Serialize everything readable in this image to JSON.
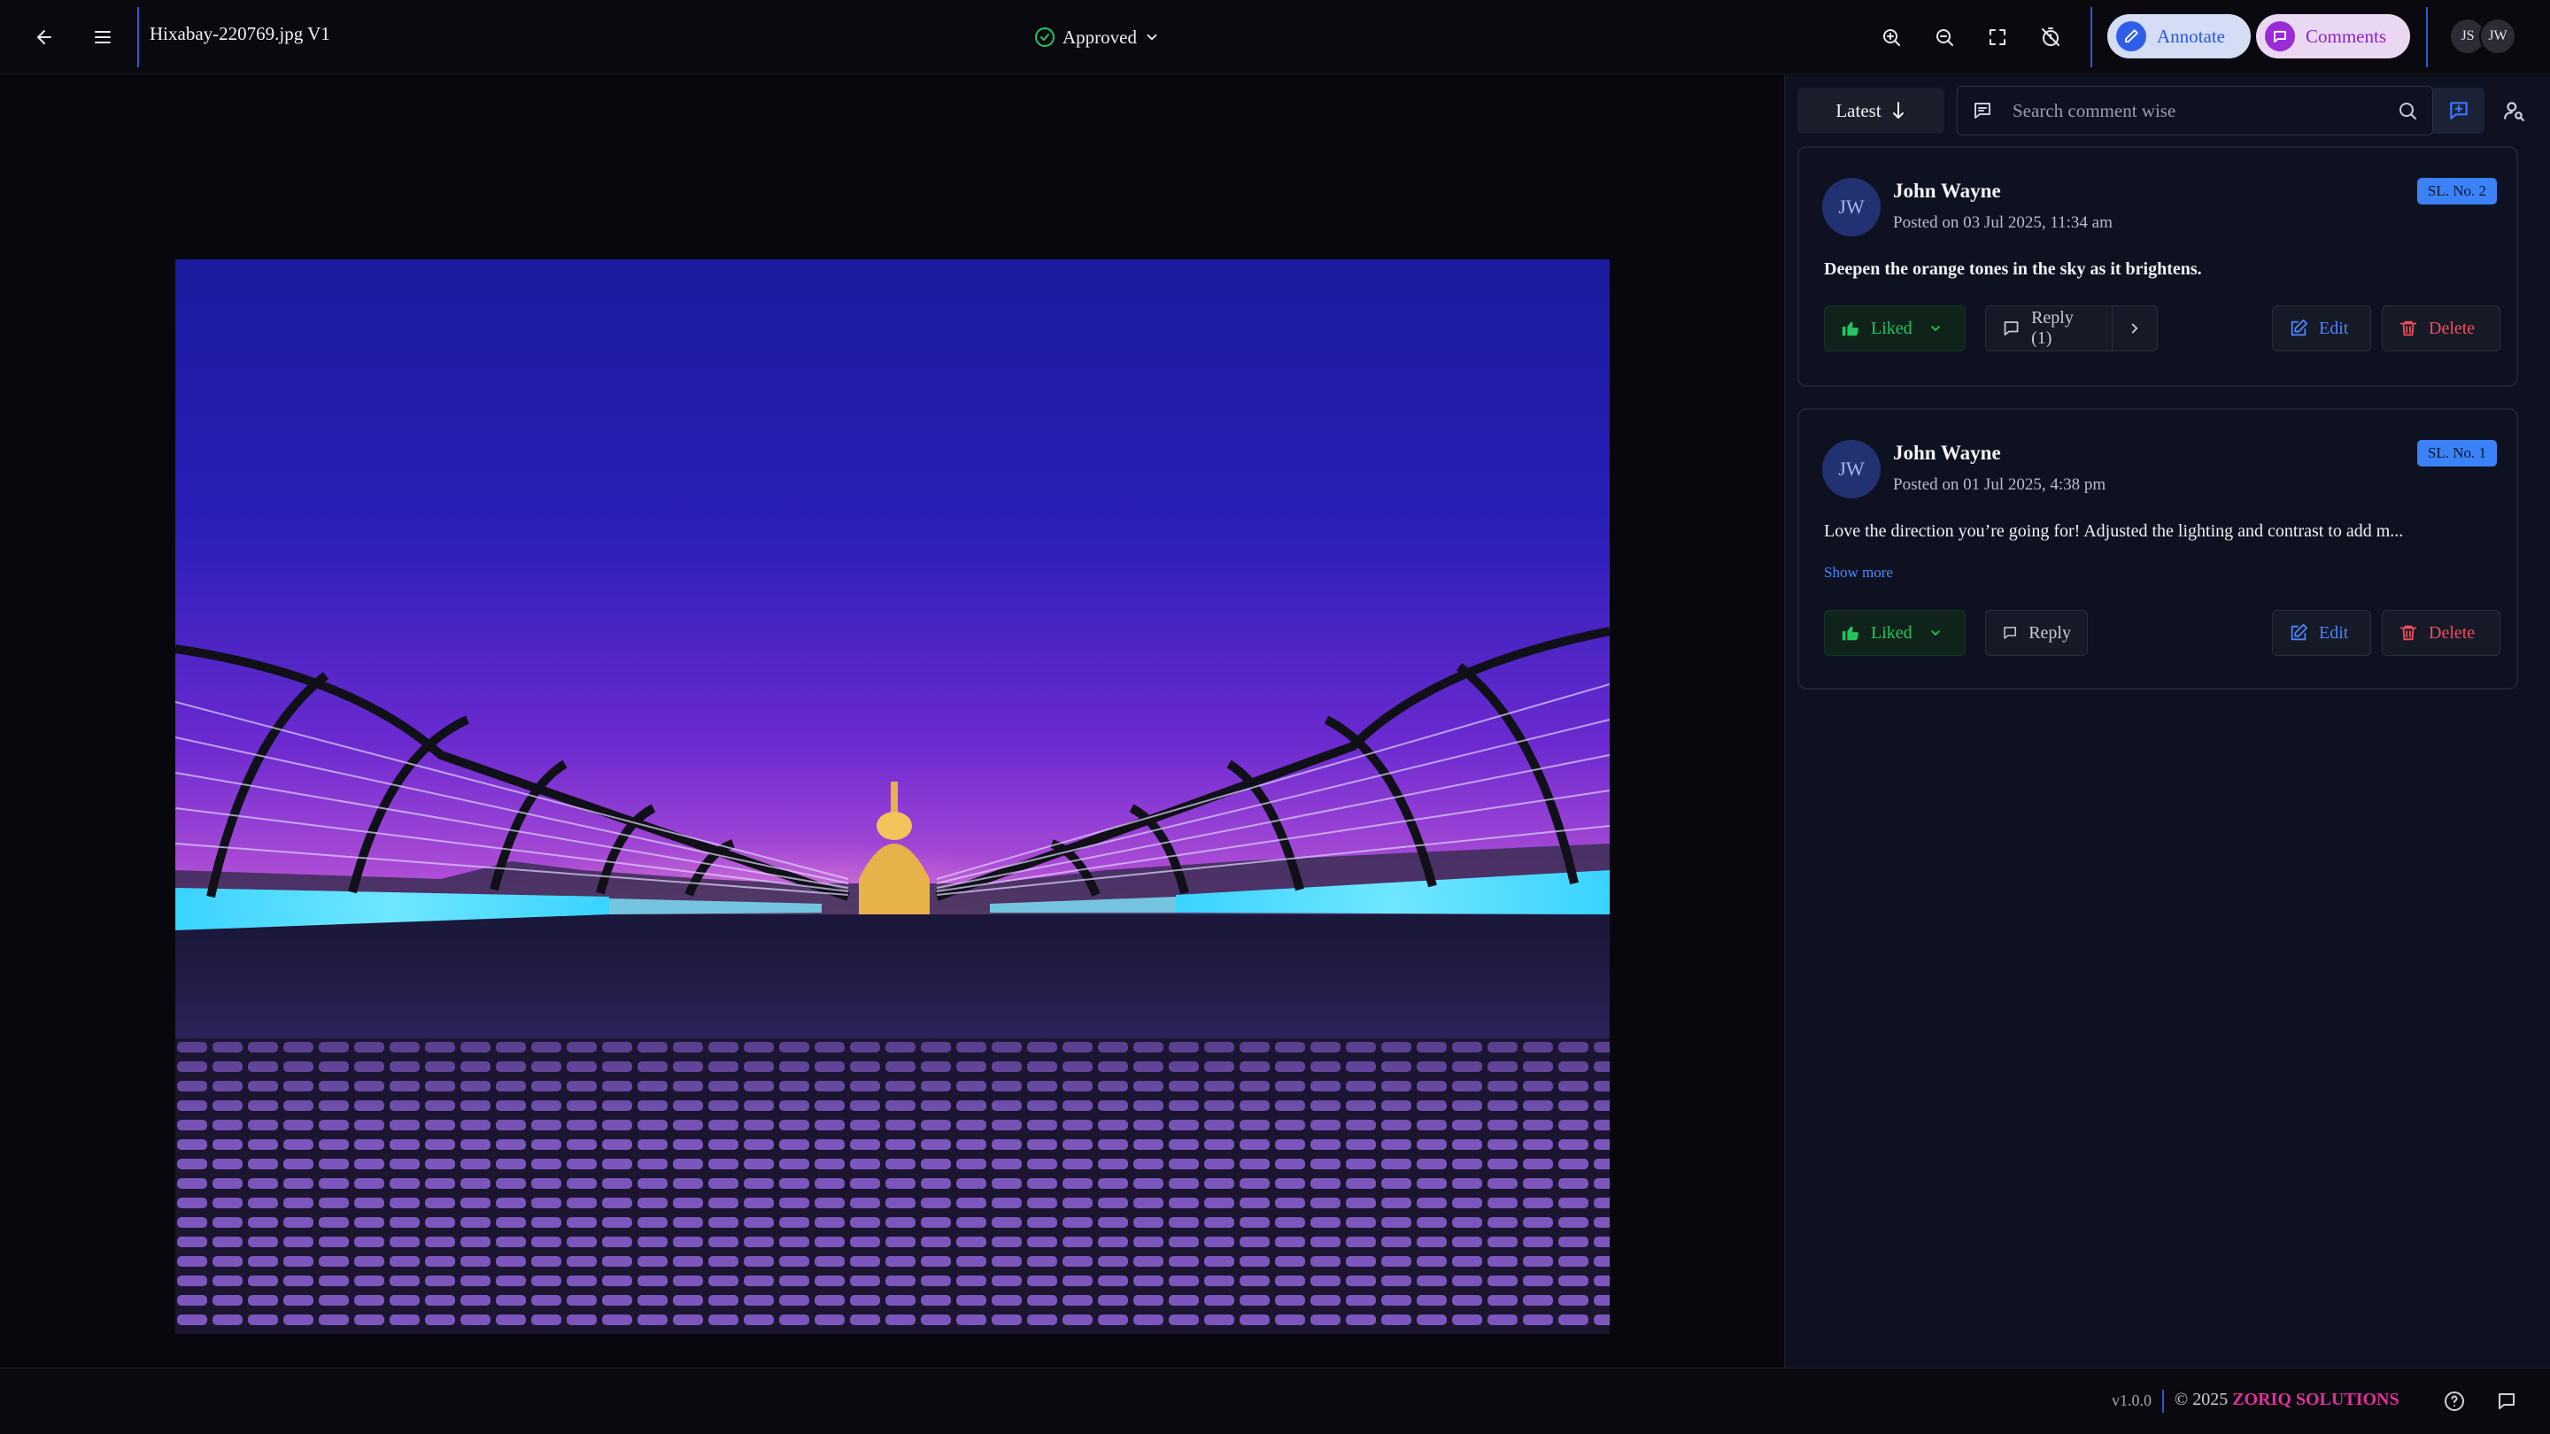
{
  "header": {
    "file_title": "Hixabay-220769.jpg V1",
    "status": "Approved",
    "annotate_label": "Annotate",
    "comments_label": "Comments",
    "avatars": [
      "JS",
      "JW"
    ],
    "icons": [
      "back-arrow-icon",
      "menu-icon",
      "check-circle-icon",
      "zoom-in-icon",
      "zoom-out-icon",
      "fullscreen-icon",
      "timer-off-icon",
      "pencil-icon",
      "chat-icon"
    ]
  },
  "viewer": {
    "image_alt": "Millennium Bridge leading to St Paul's Cathedral at dusk"
  },
  "panel": {
    "sort_label": "Latest",
    "search_placeholder": "Search comment wise",
    "comments": [
      {
        "initials": "JW",
        "author": "John Wayne",
        "posted": "Posted on 03 Jul 2025, 11:34 am",
        "serial": "SL. No. 2",
        "text": "Deepen the orange tones in the sky as it brightens.",
        "liked_label": "Liked",
        "reply_label": "Reply (1)",
        "edit_label": "Edit",
        "delete_label": "Delete"
      },
      {
        "initials": "JW",
        "author": "John Wayne",
        "posted": "Posted on 01 Jul 2025, 4:38 pm",
        "serial": "SL. No. 1",
        "text": "Love the direction you’re going for! Adjusted the lighting and contrast to add m...",
        "show_more": "Show more",
        "liked_label": "Liked",
        "reply_label": "Reply",
        "edit_label": "Edit",
        "delete_label": "Delete"
      }
    ]
  },
  "footer": {
    "version": "v1.0.0",
    "copyright_prefix": "© 2025",
    "brand": "ZORIQ SOLUTIONS"
  },
  "colors": {
    "accent_blue": "#3b82f6",
    "liked_green": "#22c55e",
    "delete_red": "#f04d5d",
    "brand_pink": "#e0309c"
  }
}
